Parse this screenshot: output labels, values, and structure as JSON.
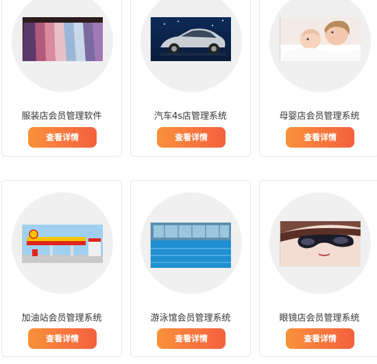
{
  "accent": {
    "button_start": "#f9913a",
    "button_end": "#f4603f"
  },
  "products": [
    {
      "title": "服装店会员管理软件",
      "button": "查看详情",
      "image": "clothing-rack-photo"
    },
    {
      "title": "汽车4s店管理系统",
      "button": "查看详情",
      "image": "silver-car-photo"
    },
    {
      "title": "母婴店会员管理系统",
      "button": "查看详情",
      "image": "mother-and-baby-photo"
    },
    {
      "title": "加油站会员管理系统",
      "button": "查看详情",
      "image": "gas-station-photo"
    },
    {
      "title": "游泳馆会员管理系统",
      "button": "查看详情",
      "image": "indoor-pool-photo"
    },
    {
      "title": "眼镜店会员管理系统",
      "button": "查看详情",
      "image": "woman-sunglasses-photo"
    }
  ]
}
